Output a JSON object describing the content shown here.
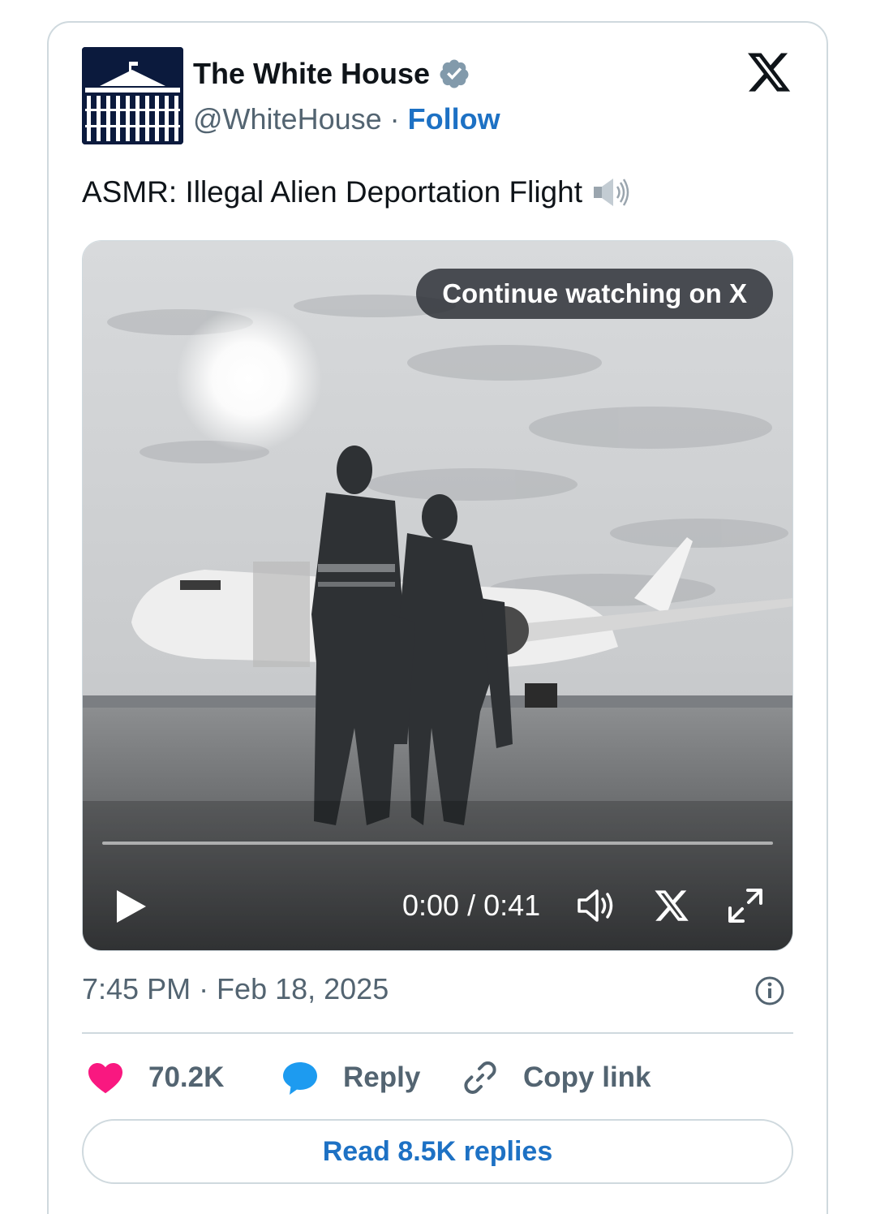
{
  "post": {
    "author_name": "The White House",
    "author_handle": "@WhiteHouse",
    "separator": "·",
    "follow_label": "Follow",
    "text": "ASMR: Illegal Alien Deportation Flight",
    "timestamp": "7:45 PM · Feb 18, 2025"
  },
  "video": {
    "continue_label": "Continue watching on X",
    "time_display": "0:00 / 0:41",
    "progress": 0
  },
  "actions": {
    "likes": "70.2K",
    "reply_label": "Reply",
    "copy_label": "Copy link",
    "read_replies_label": "Read 8.5K replies"
  },
  "icons": {
    "verified": "verified-badge-icon",
    "brand": "x-logo-icon",
    "speaker_emoji": "speaker-icon",
    "play": "play-icon",
    "volume": "volume-icon",
    "fullscreen": "fullscreen-icon",
    "info": "info-icon",
    "like": "heart-icon",
    "reply": "reply-bubble-icon",
    "link": "link-icon"
  },
  "colors": {
    "like": "#f91880",
    "reply": "#1d9bf0",
    "link_blue": "#1d71c4",
    "verified": "#829aab",
    "muted": "#536471"
  }
}
